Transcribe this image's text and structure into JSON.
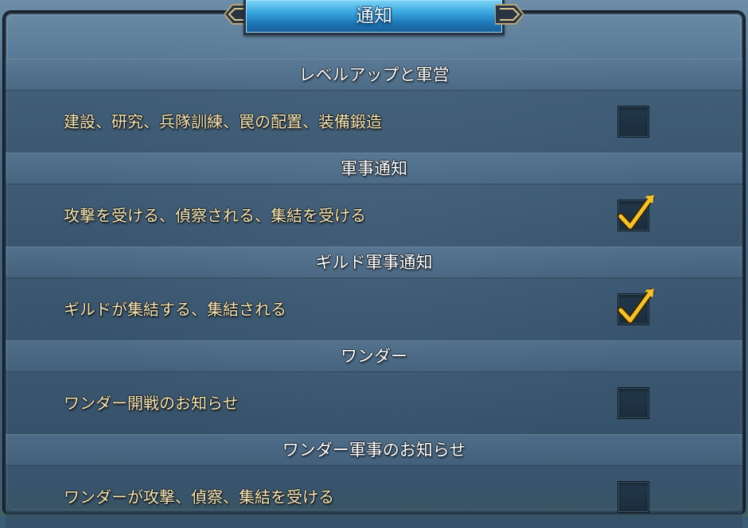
{
  "dialog": {
    "title": "通知"
  },
  "sections": [
    {
      "header": "レベルアップと軍営",
      "option": {
        "label": "建設、研究、兵隊訓練、罠の配置、装備鍛造",
        "checked": false
      }
    },
    {
      "header": "軍事通知",
      "option": {
        "label": "攻撃を受ける、偵察される、集結を受ける",
        "checked": true
      }
    },
    {
      "header": "ギルド軍事通知",
      "option": {
        "label": "ギルドが集結する、集結される",
        "checked": true
      }
    },
    {
      "header": "ワンダー",
      "option": {
        "label": "ワンダー開戦のお知らせ",
        "checked": false
      }
    },
    {
      "header": "ワンダー軍事のお知らせ",
      "option": {
        "label": "ワンダーが攻撃、偵察、集結を受ける",
        "checked": false
      }
    }
  ],
  "colors": {
    "title_plate": "#2a8fd0",
    "option_text": "#f7e7b6",
    "header_text": "#ffffff",
    "checkmark": "#f2c230"
  }
}
